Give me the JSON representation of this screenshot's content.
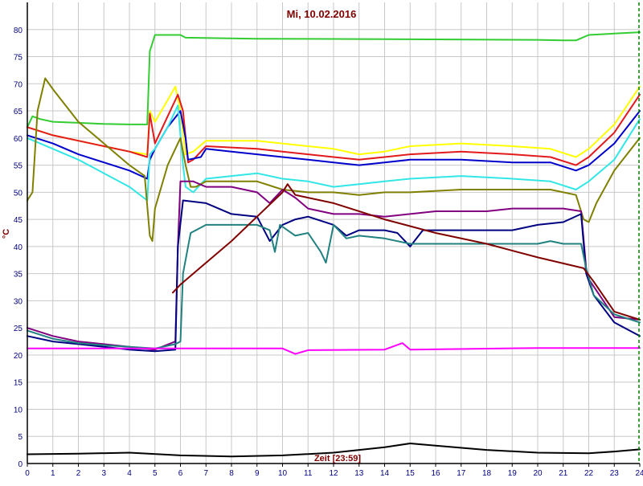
{
  "chart_data": {
    "type": "line",
    "title": "Mi, 10.02.2016",
    "ylabel": "°C",
    "xlabel": "Zeit [23:59]",
    "xlim": [
      0,
      24
    ],
    "ylim": [
      0,
      85
    ],
    "x_ticks": [
      0,
      1,
      2,
      3,
      4,
      5,
      6,
      7,
      8,
      9,
      10,
      11,
      12,
      13,
      14,
      15,
      16,
      17,
      18,
      19,
      20,
      21,
      22,
      23,
      24
    ],
    "y_ticks": [
      0,
      5,
      10,
      15,
      20,
      25,
      30,
      35,
      40,
      45,
      50,
      55,
      60,
      65,
      70,
      75,
      80
    ],
    "grid": true,
    "colors": {
      "title": "#800000",
      "ylabel": "#800000",
      "xlabel": "#800000",
      "grid": "#c8c8c8",
      "axis": "#000000",
      "tick_label": "#000080",
      "cursor": "#008000"
    },
    "series": [
      {
        "color": "#33cc33",
        "points": [
          [
            0,
            62
          ],
          [
            0.2,
            64
          ],
          [
            0.5,
            63.5
          ],
          [
            1,
            63
          ],
          [
            2,
            62.8
          ],
          [
            3,
            62.6
          ],
          [
            4,
            62.5
          ],
          [
            4.7,
            62.5
          ],
          [
            4.8,
            76
          ],
          [
            5,
            79
          ],
          [
            6,
            79
          ],
          [
            6.2,
            78.5
          ],
          [
            9,
            78.3
          ],
          [
            15,
            78.2
          ],
          [
            20,
            78.1
          ],
          [
            21,
            78
          ],
          [
            21.5,
            78
          ],
          [
            22,
            79
          ],
          [
            24,
            79.5
          ]
        ]
      },
      {
        "color": "#ffff00",
        "points": [
          [
            0,
            62
          ],
          [
            1,
            60.5
          ],
          [
            2,
            59.5
          ],
          [
            3,
            58.5
          ],
          [
            4,
            57.5
          ],
          [
            4.7,
            57
          ],
          [
            4.8,
            65
          ],
          [
            5,
            63
          ],
          [
            5.5,
            67
          ],
          [
            5.8,
            69.5
          ],
          [
            6,
            65
          ],
          [
            6.2,
            57
          ],
          [
            6.5,
            57.5
          ],
          [
            7,
            59.5
          ],
          [
            9,
            59.5
          ],
          [
            10,
            59
          ],
          [
            11,
            58.5
          ],
          [
            12,
            58
          ],
          [
            13,
            57
          ],
          [
            14,
            57.5
          ],
          [
            15,
            58.5
          ],
          [
            17,
            59
          ],
          [
            19,
            58.5
          ],
          [
            20.5,
            58
          ],
          [
            21.5,
            56.5
          ],
          [
            22,
            58
          ],
          [
            23,
            62.5
          ],
          [
            24,
            69.5
          ]
        ]
      },
      {
        "color": "#e31a1c",
        "points": [
          [
            0,
            62
          ],
          [
            1,
            60.5
          ],
          [
            2,
            59.5
          ],
          [
            3,
            58.5
          ],
          [
            4,
            57.5
          ],
          [
            4.7,
            56.5
          ],
          [
            4.8,
            64.5
          ],
          [
            5,
            59
          ],
          [
            5.5,
            64
          ],
          [
            5.9,
            68
          ],
          [
            6.1,
            65
          ],
          [
            6.3,
            55.5
          ],
          [
            6.5,
            56
          ],
          [
            7,
            58.5
          ],
          [
            9,
            58
          ],
          [
            10,
            57.5
          ],
          [
            11,
            57
          ],
          [
            12,
            56.5
          ],
          [
            13,
            56
          ],
          [
            14,
            56.5
          ],
          [
            15,
            57
          ],
          [
            17,
            57.5
          ],
          [
            19,
            57
          ],
          [
            20.5,
            56.5
          ],
          [
            21.5,
            55
          ],
          [
            22,
            56.5
          ],
          [
            23,
            61
          ],
          [
            24,
            68
          ]
        ]
      },
      {
        "color": "#0000cc",
        "points": [
          [
            0,
            60.5
          ],
          [
            1,
            59
          ],
          [
            2,
            57
          ],
          [
            3,
            55.5
          ],
          [
            4,
            54
          ],
          [
            4.7,
            52.5
          ],
          [
            4.8,
            56
          ],
          [
            5,
            58
          ],
          [
            5.5,
            62
          ],
          [
            6,
            65
          ],
          [
            6.2,
            60
          ],
          [
            6.3,
            56
          ],
          [
            6.8,
            56.5
          ],
          [
            7,
            58
          ],
          [
            8,
            57.5
          ],
          [
            9,
            57
          ],
          [
            10,
            56.5
          ],
          [
            11,
            56
          ],
          [
            12,
            55.5
          ],
          [
            13,
            55
          ],
          [
            14,
            55.5
          ],
          [
            15,
            56
          ],
          [
            17,
            56
          ],
          [
            19,
            55.5
          ],
          [
            20.5,
            55.5
          ],
          [
            21.5,
            54
          ],
          [
            22,
            55
          ],
          [
            23,
            59
          ],
          [
            24,
            65
          ]
        ]
      },
      {
        "color": "#33e6e6",
        "points": [
          [
            0,
            60
          ],
          [
            1,
            58
          ],
          [
            2,
            56
          ],
          [
            3,
            53.5
          ],
          [
            4,
            51
          ],
          [
            4.7,
            48.5
          ],
          [
            4.8,
            57
          ],
          [
            5,
            58
          ],
          [
            5.5,
            62
          ],
          [
            5.9,
            66
          ],
          [
            6.1,
            55
          ],
          [
            6.2,
            51
          ],
          [
            6.5,
            50
          ],
          [
            7,
            52.5
          ],
          [
            8,
            53
          ],
          [
            9,
            53.5
          ],
          [
            10,
            52.5
          ],
          [
            11,
            52
          ],
          [
            12,
            51
          ],
          [
            13,
            51.5
          ],
          [
            14,
            52
          ],
          [
            15,
            52.5
          ],
          [
            17,
            53
          ],
          [
            19,
            52.5
          ],
          [
            20.5,
            52
          ],
          [
            21.5,
            50.5
          ],
          [
            22,
            52
          ],
          [
            23,
            56
          ],
          [
            24,
            63.5
          ]
        ]
      },
      {
        "color": "#808000",
        "points": [
          [
            0,
            48.5
          ],
          [
            0.2,
            50
          ],
          [
            0.4,
            65
          ],
          [
            0.7,
            71
          ],
          [
            1,
            69
          ],
          [
            1.5,
            66
          ],
          [
            2,
            63
          ],
          [
            3,
            59
          ],
          [
            4,
            55
          ],
          [
            4.6,
            53
          ],
          [
            4.8,
            42
          ],
          [
            4.9,
            41
          ],
          [
            5,
            47
          ],
          [
            5.5,
            55
          ],
          [
            6,
            60
          ],
          [
            6.2,
            55
          ],
          [
            6.4,
            51
          ],
          [
            6.6,
            51
          ],
          [
            7,
            52
          ],
          [
            8,
            52
          ],
          [
            9,
            52
          ],
          [
            10,
            50.5
          ],
          [
            11,
            50
          ],
          [
            12,
            50
          ],
          [
            13,
            49.5
          ],
          [
            14,
            50
          ],
          [
            15,
            50
          ],
          [
            17,
            50.5
          ],
          [
            19,
            50.5
          ],
          [
            20.5,
            50.5
          ],
          [
            21.5,
            49.5
          ],
          [
            21.8,
            45
          ],
          [
            22,
            44.5
          ],
          [
            22.3,
            48
          ],
          [
            23,
            54
          ],
          [
            24,
            60
          ]
        ]
      },
      {
        "color": "#800080",
        "points": [
          [
            0,
            25
          ],
          [
            1,
            23.5
          ],
          [
            2,
            22.5
          ],
          [
            3,
            22
          ],
          [
            4,
            21.5
          ],
          [
            5,
            21
          ],
          [
            5.8,
            22.5
          ],
          [
            5.9,
            40
          ],
          [
            6,
            52
          ],
          [
            6.5,
            52
          ],
          [
            7,
            51
          ],
          [
            8,
            51
          ],
          [
            9,
            50
          ],
          [
            9.5,
            48
          ],
          [
            10,
            50.5
          ],
          [
            10.5,
            49
          ],
          [
            11,
            47
          ],
          [
            12,
            46
          ],
          [
            13,
            46
          ],
          [
            14,
            45.5
          ],
          [
            15,
            46
          ],
          [
            16,
            46.5
          ],
          [
            17,
            46.5
          ],
          [
            18,
            46.5
          ],
          [
            19,
            47
          ],
          [
            20,
            47
          ],
          [
            21,
            47
          ],
          [
            21.7,
            46.5
          ],
          [
            21.9,
            36
          ],
          [
            22,
            34
          ],
          [
            23,
            27
          ],
          [
            24,
            26.5
          ]
        ]
      },
      {
        "color": "#000080",
        "points": [
          [
            0,
            23.5
          ],
          [
            1,
            22.5
          ],
          [
            2,
            22
          ],
          [
            3,
            21.5
          ],
          [
            4,
            21
          ],
          [
            5,
            20.7
          ],
          [
            5.8,
            21
          ],
          [
            5.9,
            40
          ],
          [
            6.1,
            48.5
          ],
          [
            7,
            48
          ],
          [
            8,
            46
          ],
          [
            9,
            45.5
          ],
          [
            9.5,
            41
          ],
          [
            10,
            44
          ],
          [
            10.5,
            45
          ],
          [
            11,
            45.5
          ],
          [
            12,
            44
          ],
          [
            12.5,
            42
          ],
          [
            13,
            43
          ],
          [
            14,
            43
          ],
          [
            14.5,
            42.5
          ],
          [
            15,
            40
          ],
          [
            15.5,
            43
          ],
          [
            16,
            43
          ],
          [
            17,
            43
          ],
          [
            18,
            43
          ],
          [
            19,
            43
          ],
          [
            20,
            44
          ],
          [
            21,
            44.5
          ],
          [
            21.7,
            46
          ],
          [
            21.9,
            35
          ],
          [
            22.2,
            31
          ],
          [
            23,
            26
          ],
          [
            24,
            23.5
          ]
        ]
      },
      {
        "color": "#218080",
        "points": [
          [
            0,
            24.5
          ],
          [
            1,
            23
          ],
          [
            2,
            22.2
          ],
          [
            3,
            21.8
          ],
          [
            4,
            21.5
          ],
          [
            5,
            21.2
          ],
          [
            5.8,
            22
          ],
          [
            6,
            22.5
          ],
          [
            6.1,
            35
          ],
          [
            6.4,
            42.5
          ],
          [
            7,
            44
          ],
          [
            8,
            44
          ],
          [
            9,
            44
          ],
          [
            9.5,
            43
          ],
          [
            9.7,
            39
          ],
          [
            9.9,
            44
          ],
          [
            10.5,
            42
          ],
          [
            11,
            42.5
          ],
          [
            11.5,
            39
          ],
          [
            11.7,
            37
          ],
          [
            12,
            44
          ],
          [
            12.5,
            41.5
          ],
          [
            13,
            42
          ],
          [
            14,
            41.5
          ],
          [
            15,
            40.5
          ],
          [
            16,
            40.5
          ],
          [
            17,
            40.5
          ],
          [
            18,
            40.5
          ],
          [
            19,
            40.5
          ],
          [
            20,
            40.5
          ],
          [
            20.5,
            41
          ],
          [
            21,
            40.5
          ],
          [
            21.7,
            40.5
          ],
          [
            21.9,
            36
          ],
          [
            22.2,
            31
          ],
          [
            23,
            27.5
          ],
          [
            24,
            26
          ]
        ]
      },
      {
        "color": "#800000",
        "points": [
          [
            5.7,
            31.5
          ],
          [
            6,
            33
          ],
          [
            7,
            37
          ],
          [
            8,
            41
          ],
          [
            9,
            45.5
          ],
          [
            10,
            50
          ],
          [
            10.2,
            51.5
          ],
          [
            10.5,
            49.5
          ],
          [
            12,
            48
          ],
          [
            14,
            45
          ],
          [
            16,
            42.5
          ],
          [
            18,
            40.5
          ],
          [
            20,
            38
          ],
          [
            21.8,
            36
          ],
          [
            22.2,
            33.5
          ],
          [
            23,
            28
          ],
          [
            24,
            26.5
          ]
        ]
      },
      {
        "color": "#ff00ff",
        "points": [
          [
            0,
            21.2
          ],
          [
            10,
            21.2
          ],
          [
            10.5,
            20.2
          ],
          [
            11,
            20.9
          ],
          [
            14,
            21
          ],
          [
            14.7,
            22.2
          ],
          [
            15,
            21
          ],
          [
            20,
            21.3
          ],
          [
            21,
            21.3
          ],
          [
            24,
            21.3
          ]
        ]
      },
      {
        "color": "#000000",
        "points": [
          [
            0,
            1.7
          ],
          [
            2,
            1.8
          ],
          [
            4,
            2.0
          ],
          [
            6,
            1.5
          ],
          [
            8,
            1.3
          ],
          [
            10,
            1.5
          ],
          [
            12,
            2.0
          ],
          [
            14,
            3.0
          ],
          [
            15,
            3.7
          ],
          [
            16,
            3.3
          ],
          [
            18,
            2.5
          ],
          [
            20,
            2.0
          ],
          [
            22,
            1.9
          ],
          [
            23,
            2.2
          ],
          [
            24,
            2.6
          ]
        ]
      }
    ]
  }
}
